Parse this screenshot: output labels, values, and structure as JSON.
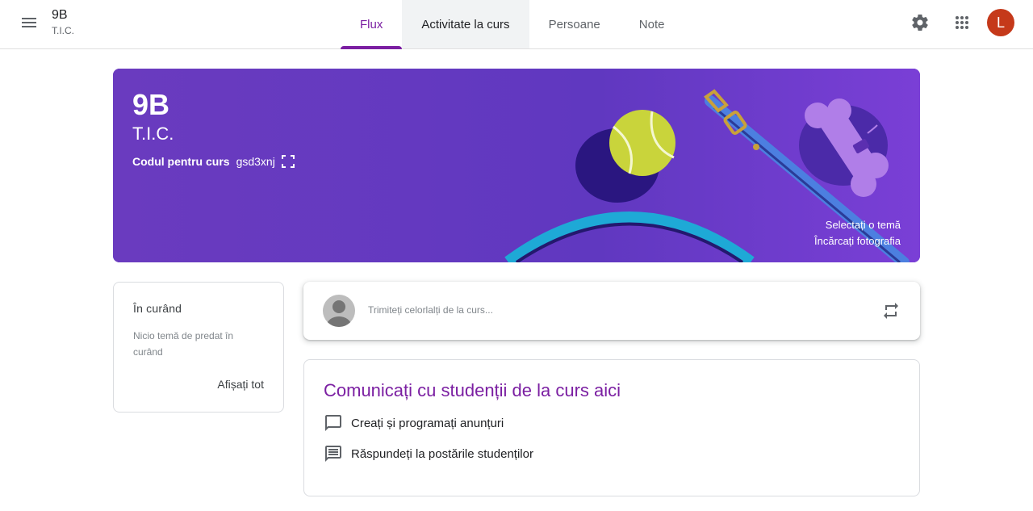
{
  "header": {
    "class_name": "9B",
    "section": "T.I.C.",
    "tabs": [
      {
        "label": "Flux"
      },
      {
        "label": "Activitate la curs"
      },
      {
        "label": "Persoane"
      },
      {
        "label": "Note"
      }
    ],
    "avatar_letter": "L",
    "icons": {
      "menu": "menu-icon",
      "settings": "gear-icon",
      "apps": "apps-grid-icon"
    },
    "colors": {
      "accent": "#7b1fa2",
      "avatar": "#c5391a"
    }
  },
  "banner": {
    "title": "9B",
    "subtitle": "T.I.C.",
    "code_label": "Codul pentru curs",
    "code_value": "gsd3xnj",
    "select_theme": "Selectați o temă",
    "upload_photo": "Încărcați fotografia",
    "colors": {
      "background": "#6c3bc1"
    }
  },
  "upcoming": {
    "title": "În curând",
    "empty_text": "Nicio temă de predat în curând",
    "view_all": "Afișați tot"
  },
  "share": {
    "placeholder": "Trimiteți celorlalți de la curs..."
  },
  "communicate": {
    "title": "Comunicați cu studenții de la curs aici",
    "items": [
      {
        "label": "Creați și programați anunțuri",
        "icon": "comment-icon"
      },
      {
        "label": "Răspundeți la postările studenților",
        "icon": "message-lines-icon"
      }
    ]
  }
}
